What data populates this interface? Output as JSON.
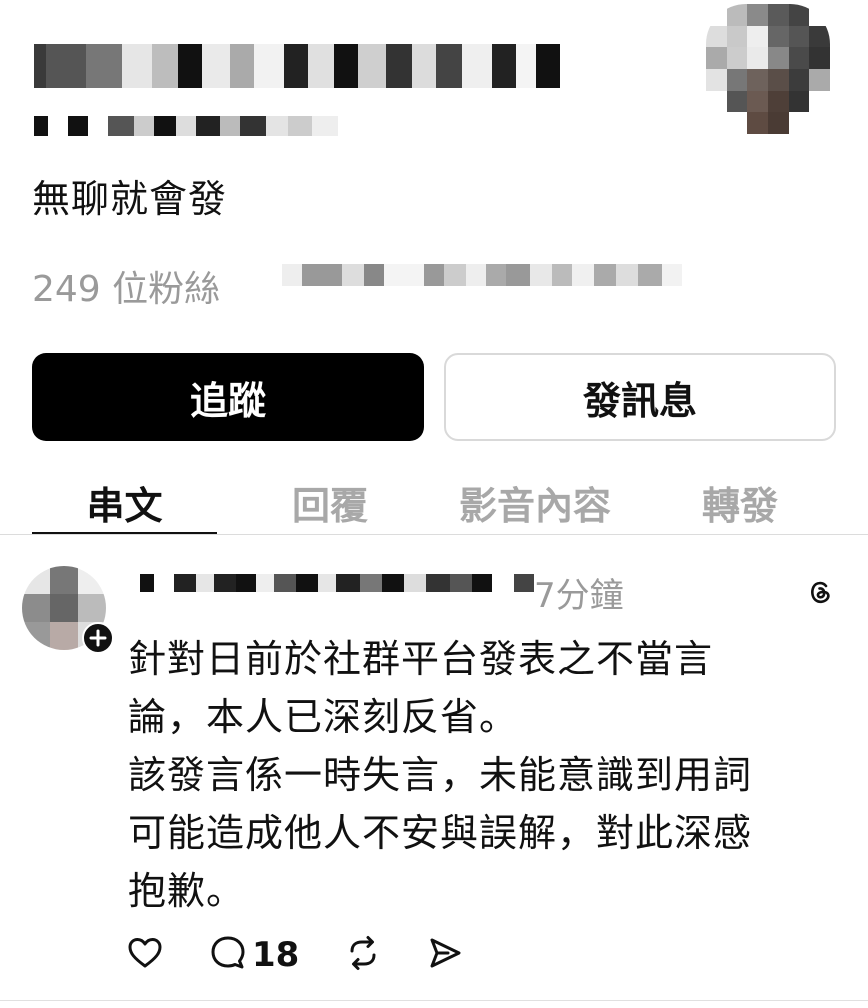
{
  "profile": {
    "bio": "無聊就會發",
    "followers": "249 位粉絲"
  },
  "buttons": {
    "follow": "追蹤",
    "message": "發訊息"
  },
  "tabs": [
    {
      "label": "串文",
      "active": true
    },
    {
      "label": "回覆",
      "active": false
    },
    {
      "label": "影音內容",
      "active": false
    },
    {
      "label": "轉發",
      "active": false
    }
  ],
  "post": {
    "time": "7分鐘",
    "lines": [
      "針對日前於社群平台發表之不當言",
      "論，本人已深刻反省。",
      "該發言係一時失言，未能意識到用詞",
      "可能造成他人不安與誤解，對此深感",
      "抱歉。"
    ],
    "reply_count": "18"
  },
  "icons": {
    "threads": "threads-logo-icon",
    "like": "heart-icon",
    "reply": "comment-icon",
    "repost": "repost-icon",
    "share": "send-icon"
  },
  "colors": {
    "follow_button_bg": "#000000",
    "muted_text": "#9a9a9a",
    "inactive_tab": "#a8a8a8"
  }
}
